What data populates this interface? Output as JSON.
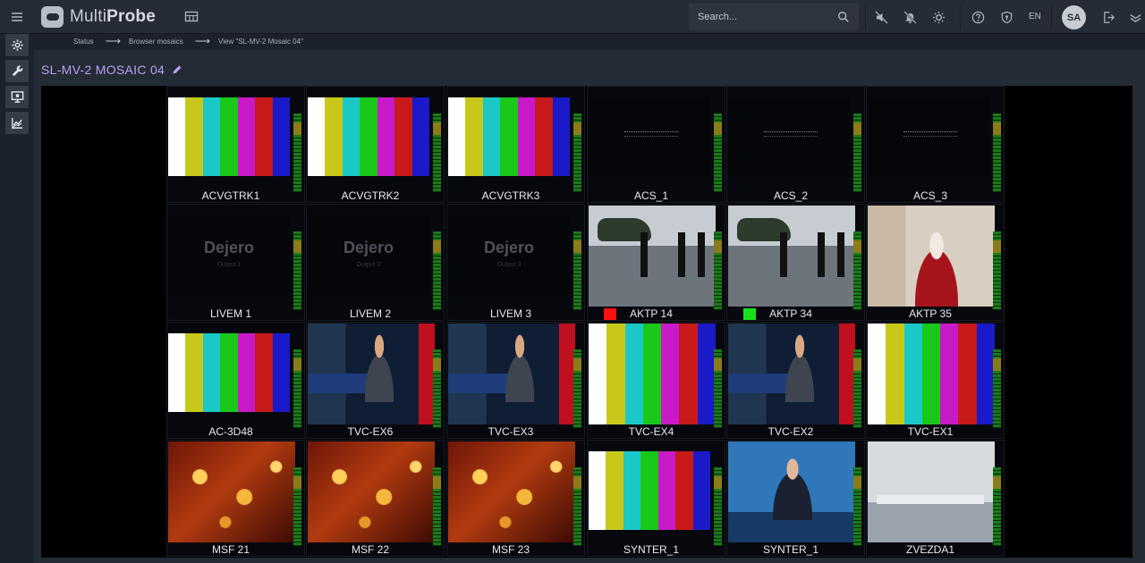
{
  "app": {
    "name_light": "Multi",
    "name_bold": "Probe"
  },
  "search": {
    "placeholder": "Search..."
  },
  "header": {
    "language": "EN",
    "user_initials": "SA"
  },
  "breadcrumb": [
    "Status",
    "Browser mosaics",
    "View \"SL-MV-2 Mosaic 04\""
  ],
  "page": {
    "title": "SL-MV-2 MOSAIC 04"
  },
  "status_colors": {
    "red": "#ff1010",
    "green": "#18e018"
  },
  "color_bars": [
    "#ffffff",
    "#c8c81a",
    "#1ac8c8",
    "#1ac81a",
    "#c81ac8",
    "#c81a1a",
    "#1a1ac8"
  ],
  "tiles": [
    {
      "label": "ACVGTRK1",
      "type": "bars"
    },
    {
      "label": "ACVGTRK2",
      "type": "bars"
    },
    {
      "label": "ACVGTRK3",
      "type": "bars"
    },
    {
      "label": "ACS_1",
      "type": "slate"
    },
    {
      "label": "ACS_2",
      "type": "slate"
    },
    {
      "label": "ACS_3",
      "type": "slate"
    },
    {
      "label": "LIVEM 1",
      "type": "dejero",
      "logo": "Dejero",
      "sub": "Output 1"
    },
    {
      "label": "LIVEM 2",
      "type": "dejero",
      "logo": "Dejero",
      "sub": "Output 2"
    },
    {
      "label": "LIVEM 3",
      "type": "dejero",
      "logo": "Dejero",
      "sub": "Output 3"
    },
    {
      "label": "AKTP 14",
      "type": "heli",
      "status": "red"
    },
    {
      "label": "AKTP 34",
      "type": "heli",
      "status": "green"
    },
    {
      "label": "AKTP 35",
      "type": "lady"
    },
    {
      "label": "AC-3D48",
      "type": "bars"
    },
    {
      "label": "TVC-EX6",
      "type": "news"
    },
    {
      "label": "TVC-EX3",
      "type": "news"
    },
    {
      "label": "TVC-EX4",
      "type": "bars-full"
    },
    {
      "label": "TVC-EX2",
      "type": "news"
    },
    {
      "label": "TVC-EX1",
      "type": "bars-full"
    },
    {
      "label": "MSF 21",
      "type": "stars"
    },
    {
      "label": "MSF 22",
      "type": "stars"
    },
    {
      "label": "MSF 23",
      "type": "stars"
    },
    {
      "label": "SYNTER_1",
      "type": "bars"
    },
    {
      "label": "SYNTER_1",
      "type": "press"
    },
    {
      "label": "ZVEZDA1",
      "type": "studio"
    }
  ]
}
